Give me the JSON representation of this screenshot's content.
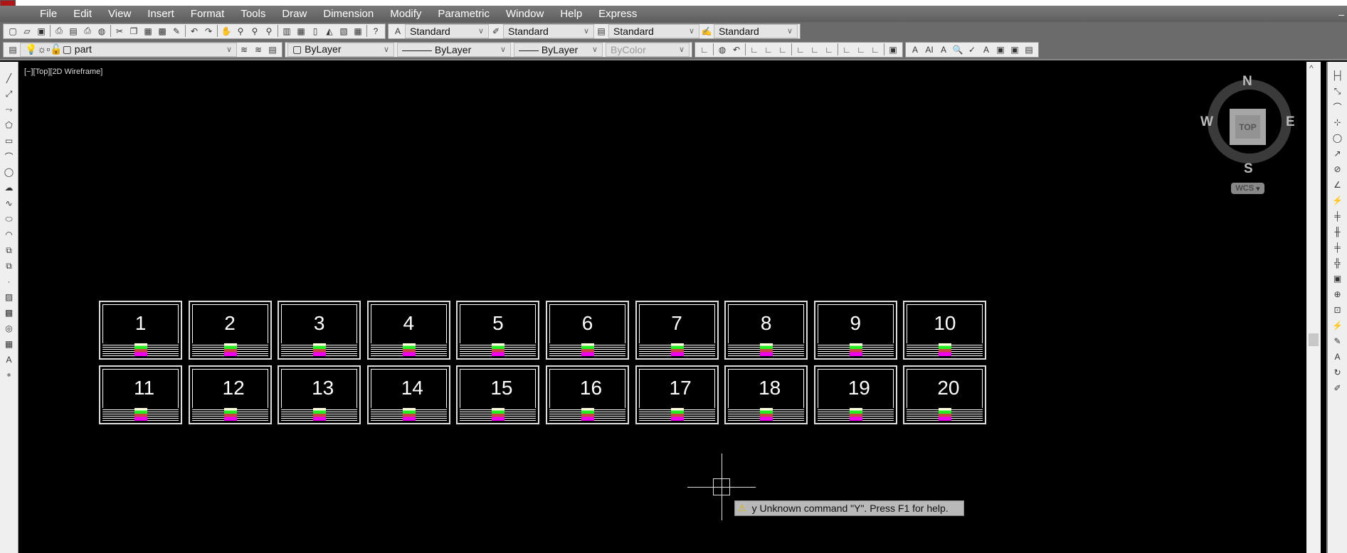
{
  "menu": [
    "File",
    "Edit",
    "View",
    "Insert",
    "Format",
    "Tools",
    "Draw",
    "Dimension",
    "Modify",
    "Parametric",
    "Window",
    "Help",
    "Express"
  ],
  "toolbar": {
    "text_style": "Standard",
    "dim_style": "Standard",
    "table_style": "Standard",
    "mleader_style": "Standard",
    "layer": "part",
    "color": "ByLayer",
    "linetype": "ByLayer",
    "lineweight": "ByLayer",
    "plotstyle": "ByColor"
  },
  "viewport": {
    "label": "[−][Top][2D Wireframe]"
  },
  "viewcube": {
    "top": "TOP",
    "n": "N",
    "s": "S",
    "e": "E",
    "w": "W",
    "ucs": "WCS"
  },
  "sheets": [
    "1",
    "2",
    "3",
    "4",
    "5",
    "6",
    "7",
    "8",
    "9",
    "10",
    "11",
    "12",
    "13",
    "14",
    "15",
    "16",
    "17",
    "18",
    "19",
    "20"
  ],
  "command_tooltip": "y Unknown command \"Y\".  Press F1 for help."
}
